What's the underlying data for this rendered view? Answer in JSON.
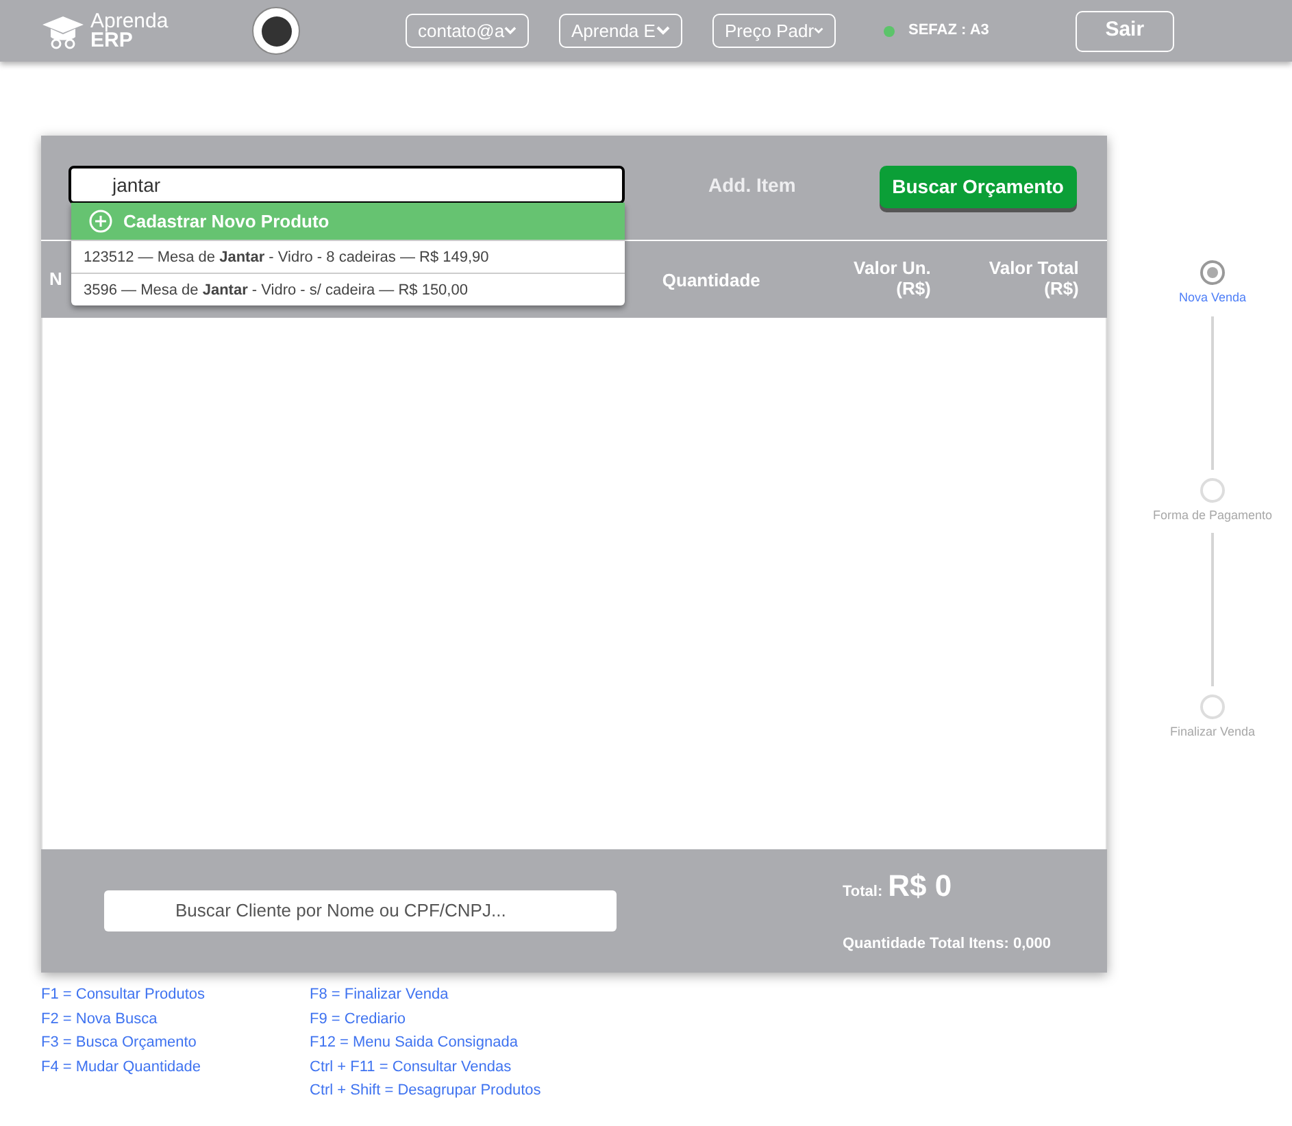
{
  "header": {
    "logo_top": "Aprenda",
    "logo_bottom": "ERP",
    "selects": [
      "contato@a",
      "Aprenda E",
      "Preço Padr"
    ],
    "status": {
      "label": "SEFAZ : A3",
      "online": true
    },
    "logout": "Sair"
  },
  "search": {
    "value": "jantar",
    "add_item": "Add. Item",
    "budget_button": "Buscar Orçamento"
  },
  "suggestions": {
    "create": "Cadastrar Novo Produto",
    "items": [
      "123512 — Mesa de **Jantar** - Vidro - 8 cadeiras — R$ 149,90",
      "3596 — Mesa de **Jantar** - Vidro - s/ cadeira — R$ 150,00"
    ]
  },
  "table": {
    "columns": [
      "N",
      "Quantidade",
      "Valor Un. (R$)",
      "Valor Total (R$)"
    ]
  },
  "footer": {
    "client_placeholder": "Buscar Cliente por Nome ou CPF/CNPJ...",
    "total_label": "Total:",
    "total_value": "R$ 0",
    "quantity": "Quantidade Total Itens: 0,000"
  },
  "steps": [
    {
      "label": "Nova Venda",
      "selected": true
    },
    {
      "label": "Forma de Pagamento",
      "selected": false
    },
    {
      "label": "Finalizar Venda",
      "selected": false
    }
  ],
  "shortcuts": [
    [
      "F1 = Consultar Produtos",
      "F2 = Nova Busca",
      "F3 = Busca Orçamento",
      "F4 = Mudar Quantidade"
    ],
    [
      "F8 = Finalizar Venda",
      "F9 = Crediario",
      "F12 = Menu Saida Consignada",
      "Ctrl + F11 = Consultar Vendas",
      "Ctrl + Shift = Desagrupar Produtos"
    ]
  ]
}
